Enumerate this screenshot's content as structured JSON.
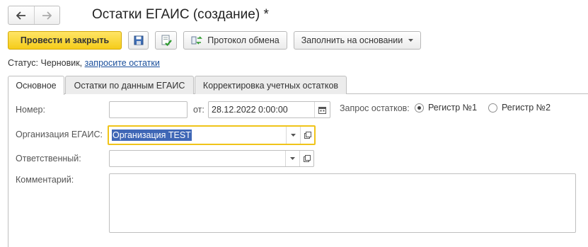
{
  "window": {
    "title": "Остатки ЕГАИС (создание) *"
  },
  "toolbar": {
    "post_and_close": "Провести и закрыть",
    "exchange_protocol": "Протокол обмена",
    "fill_based_on": "Заполнить на основании"
  },
  "status": {
    "label": "Статус:",
    "value": "Черновик,",
    "link": "запросите остатки"
  },
  "tabs": [
    {
      "label": "Основное",
      "active": true
    },
    {
      "label": "Остатки по данным ЕГАИС",
      "active": false
    },
    {
      "label": "Корректировка учетных остатков",
      "active": false
    }
  ],
  "form": {
    "number_label": "Номер:",
    "number_value": "",
    "date_label": "от:",
    "date_value": "28.12.2022  0:00:00",
    "request_label": "Запрос остатков:",
    "register1": "Регистр №1",
    "register2": "Регистр №2",
    "selected_register": "Регистр №1",
    "org_label": "Организация ЕГАИС:",
    "org_value": "Организация TEST",
    "responsible_label": "Ответственный:",
    "responsible_value": "",
    "comment_label": "Комментарий:",
    "comment_value": ""
  },
  "colors": {
    "primary_button": "#f5cc1a",
    "link": "#1a4f9c",
    "focus_border": "#f0c419",
    "selection": "#3f67b6"
  },
  "icons": [
    "arrow-left-icon",
    "arrow-right-icon",
    "save-icon",
    "post-document-icon",
    "exchange-icon",
    "dropdown-icon",
    "calendar-icon",
    "open-form-icon"
  ]
}
